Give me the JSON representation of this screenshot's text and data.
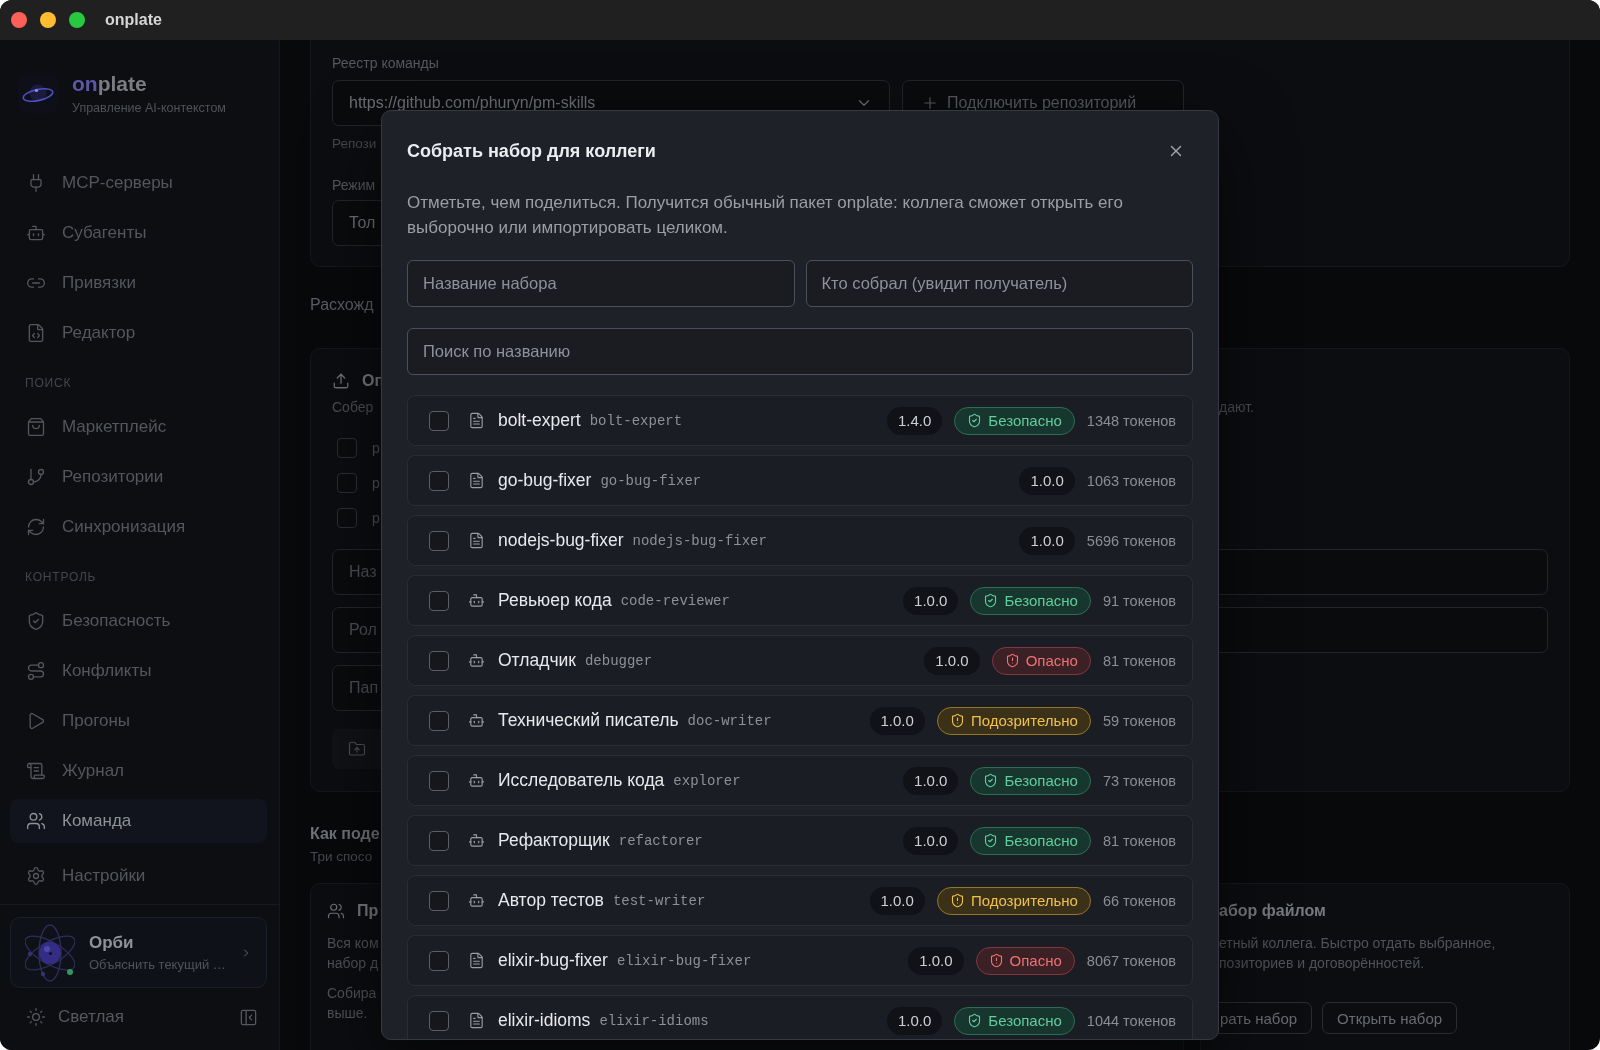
{
  "window": {
    "title": "onplate"
  },
  "sidebar": {
    "brand": {
      "name": [
        {
          "text": "on",
          "accent": true
        },
        {
          "text": "plate",
          "accent": false
        }
      ],
      "tagline": "Управление AI-контекстом"
    },
    "sections": [
      {
        "items": [
          {
            "label": "MCP-серверы",
            "selected": false
          },
          {
            "label": "Субагенты",
            "selected": false
          },
          {
            "label": "Привязки",
            "selected": false
          },
          {
            "label": "Редактор",
            "selected": false
          }
        ]
      },
      {
        "title": "ПОИСК",
        "items": [
          {
            "label": "Маркетплейс",
            "selected": false
          },
          {
            "label": "Репозитории",
            "selected": false
          },
          {
            "label": "Синхронизация",
            "selected": false
          }
        ]
      },
      {
        "title": "КОНТРОЛЬ",
        "items": [
          {
            "label": "Безопасность",
            "selected": false
          },
          {
            "label": "Конфликты",
            "selected": false
          },
          {
            "label": "Прогоны",
            "selected": false
          },
          {
            "label": "Журнал",
            "selected": false
          },
          {
            "label": "Команда",
            "selected": true
          }
        ]
      }
    ],
    "settings": {
      "label": "Настройки",
      "selected": false
    },
    "assistant": {
      "name": "Орби",
      "hint": "Объяснить текущий …",
      "online": true
    },
    "theme_toggle": {
      "label": "Светлая"
    }
  },
  "registry": {
    "label": "Реестр команды",
    "repository": {
      "value": "https://github.com/phuryn/pm-skills"
    },
    "connect_button": {
      "label": "Подключить репозиторий"
    },
    "hint": "Репози",
    "mode": {
      "label": "Режим",
      "value": "Тол"
    }
  },
  "divergence": {
    "heading": "Расхожд"
  },
  "export_card": {
    "title": "Оп",
    "description": "Собер",
    "description_tail": "дают.",
    "options": [
      {
        "label": "р",
        "checked": false
      },
      {
        "label": "р",
        "checked": false
      },
      {
        "label": "р",
        "checked": false
      }
    ],
    "fields": [
      {
        "placeholder": "Наз"
      },
      {
        "placeholder": "Рол"
      },
      {
        "placeholder": "Пап"
      }
    ]
  },
  "share": {
    "heading": "Как поде",
    "subheading": "Три спосо",
    "cards": [
      {
        "kind": "team",
        "title": "Пр",
        "paragraphs": [
          [
            "Вся ком",
            "набор д"
          ],
          [
            "Собира",
            "выше."
          ]
        ]
      },
      {
        "kind": "file",
        "title": "абор файлом",
        "paragraphs": [
          [
            "етный коллега. Быстро отдать выбранное,",
            "позиториев и договорённостей."
          ]
        ],
        "buttons": [
          "рать набор",
          "Открыть набор"
        ]
      }
    ]
  },
  "modal": {
    "title": "Собрать набор для коллеги",
    "description": "Отметьте, чем поделиться. Получится обычный пакет onplate: коллега сможет открыть его выборочно или импортировать целиком.",
    "fields": [
      {
        "placeholder": "Название набора"
      },
      {
        "placeholder": "Кто собрал (увидит получатель)"
      }
    ],
    "search": {
      "placeholder": "Поиск по названию"
    },
    "items": [
      {
        "kind": "skill",
        "name": "bolt-expert",
        "slug": "bolt-expert",
        "version": "1.4.0",
        "safety": {
          "kind": "safe",
          "label": "Безопасно"
        },
        "tokens": "1348 токенов",
        "checked": false
      },
      {
        "kind": "skill",
        "name": "go-bug-fixer",
        "slug": "go-bug-fixer",
        "version": "1.0.0",
        "tokens": "1063 токенов",
        "checked": false
      },
      {
        "kind": "skill",
        "name": "nodejs-bug-fixer",
        "slug": "nodejs-bug-fixer",
        "version": "1.0.0",
        "tokens": "5696 токенов",
        "checked": false
      },
      {
        "kind": "agent",
        "name": "Ревьюер кода",
        "slug": "code-reviewer",
        "version": "1.0.0",
        "safety": {
          "kind": "safe",
          "label": "Безопасно"
        },
        "tokens": "91 токенов",
        "checked": false
      },
      {
        "kind": "agent",
        "name": "Отладчик",
        "slug": "debugger",
        "version": "1.0.0",
        "safety": {
          "kind": "danger",
          "label": "Опасно"
        },
        "tokens": "81 токенов",
        "checked": false
      },
      {
        "kind": "agent",
        "name": "Технический писатель",
        "slug": "doc-writer",
        "version": "1.0.0",
        "safety": {
          "kind": "warn",
          "label": "Подозрительно"
        },
        "tokens": "59 токенов",
        "checked": false
      },
      {
        "kind": "agent",
        "name": "Исследователь кода",
        "slug": "explorer",
        "version": "1.0.0",
        "safety": {
          "kind": "safe",
          "label": "Безопасно"
        },
        "tokens": "73 токенов",
        "checked": false
      },
      {
        "kind": "agent",
        "name": "Рефакторщик",
        "slug": "refactorer",
        "version": "1.0.0",
        "safety": {
          "kind": "safe",
          "label": "Безопасно"
        },
        "tokens": "81 токенов",
        "checked": false
      },
      {
        "kind": "agent",
        "name": "Автор тестов",
        "slug": "test-writer",
        "version": "1.0.0",
        "safety": {
          "kind": "warn",
          "label": "Подозрительно"
        },
        "tokens": "66 токенов",
        "checked": false
      },
      {
        "kind": "skill",
        "name": "elixir-bug-fixer",
        "slug": "elixir-bug-fixer",
        "version": "1.0.0",
        "safety": {
          "kind": "danger",
          "label": "Опасно"
        },
        "tokens": "8067 токенов",
        "checked": false
      },
      {
        "kind": "skill",
        "name": "elixir-idioms",
        "slug": "elixir-idioms",
        "version": "1.0.0",
        "safety": {
          "kind": "safe",
          "label": "Безопасно"
        },
        "tokens": "1044 токенов",
        "checked": false
      }
    ]
  }
}
